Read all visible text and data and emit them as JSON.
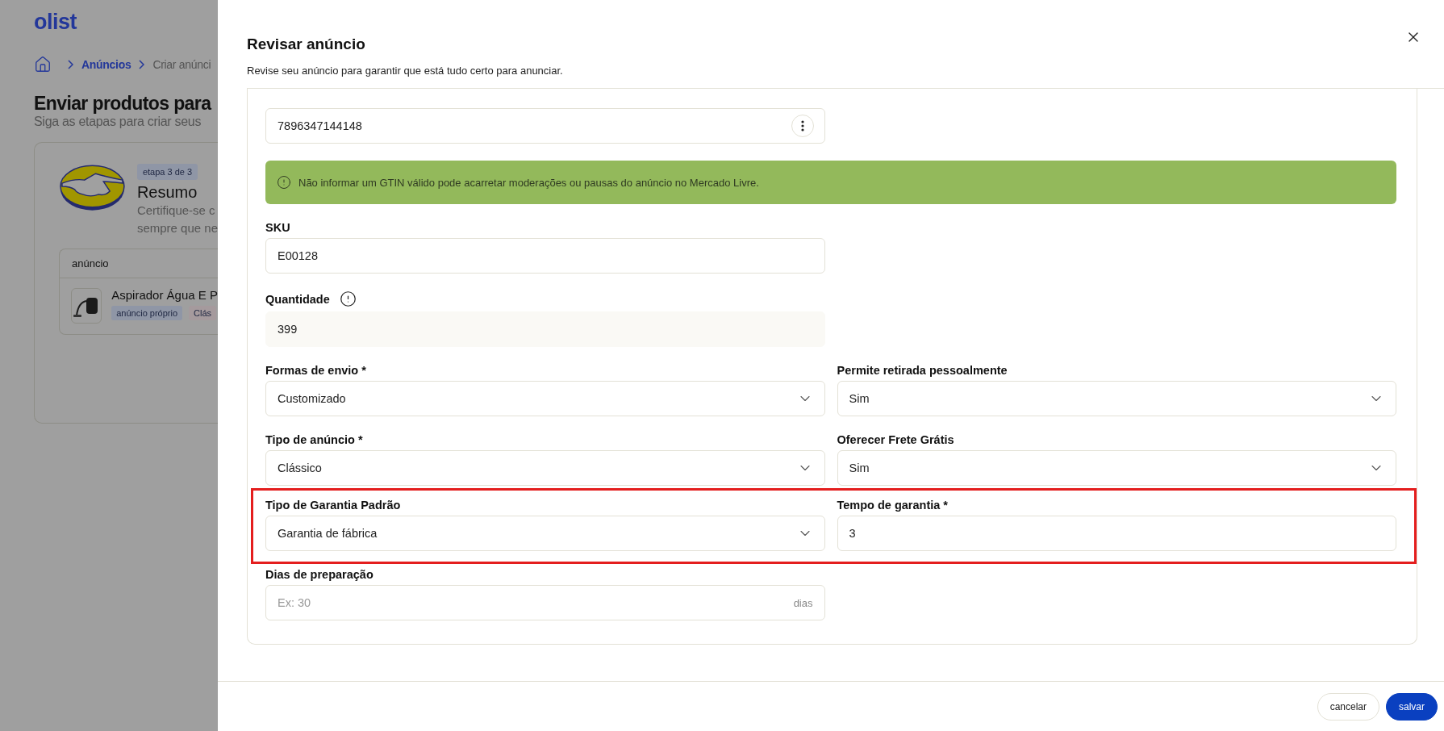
{
  "background_page": {
    "logo": "olist",
    "breadcrumb": [
      {
        "label": "Anúncios",
        "kind": "link"
      },
      {
        "label": "Criar anúnci",
        "kind": "current"
      }
    ],
    "heading": "Enviar produtos para",
    "subheading": "Siga as etapas para criar seus",
    "step_card": {
      "badge": "etapa 3 de 3",
      "title": "Resumo",
      "description_lines": [
        "Certifique-se c",
        "sempre que ne"
      ],
      "table": {
        "column_1": "anúncio",
        "rows": [
          {
            "title": "Aspirador Água E P",
            "tags": [
              "anúncio próprio",
              "Clás"
            ]
          }
        ]
      }
    }
  },
  "dialog": {
    "title": "Revisar anúncio",
    "subtitle": "Revise seu anúncio para garantir que está tudo certo para anunciar.",
    "rows": [
      {
        "kind": "fields",
        "highlighted": false,
        "fields": [
          {
            "kind": "menu",
            "value": "7896347144148"
          }
        ]
      },
      {
        "kind": "alert",
        "highlighted": false,
        "text": "Não informar um GTIN válido pode acarretar moderações ou pausas do anúncio no Mercado Livre."
      },
      {
        "kind": "fields",
        "highlighted": false,
        "fields": [
          {
            "kind": "text",
            "label": "SKU",
            "value": "E00128"
          }
        ]
      },
      {
        "kind": "fields",
        "highlighted": false,
        "fields": [
          {
            "kind": "readonly",
            "label": "Quantidade",
            "info": true,
            "value": "399"
          }
        ]
      },
      {
        "kind": "fields",
        "highlighted": false,
        "fields": [
          {
            "kind": "select",
            "label": "Formas de envio *",
            "value": "Customizado"
          },
          {
            "kind": "select",
            "label": "Permite retirada pessoalmente",
            "value": "Sim"
          }
        ]
      },
      {
        "kind": "fields",
        "highlighted": false,
        "fields": [
          {
            "kind": "select",
            "label": "Tipo de anúncio *",
            "value": "Clássico"
          },
          {
            "kind": "select",
            "label": "Oferecer Frete Grátis",
            "value": "Sim"
          }
        ]
      },
      {
        "kind": "fields",
        "highlighted": true,
        "fields": [
          {
            "kind": "select",
            "label": "Tipo de Garantia Padrão",
            "value": "Garantia de fábrica"
          },
          {
            "kind": "text",
            "label": "Tempo de garantia *",
            "value": "3"
          }
        ]
      },
      {
        "kind": "fields",
        "highlighted": false,
        "fields": [
          {
            "kind": "suffix",
            "label": "Dias de preparação",
            "placeholder": "Ex: 30",
            "suffix": "dias"
          }
        ]
      }
    ],
    "buttons": [
      {
        "label": "cancelar",
        "kind": "secondary"
      },
      {
        "label": "salvar",
        "kind": "primary"
      }
    ]
  }
}
